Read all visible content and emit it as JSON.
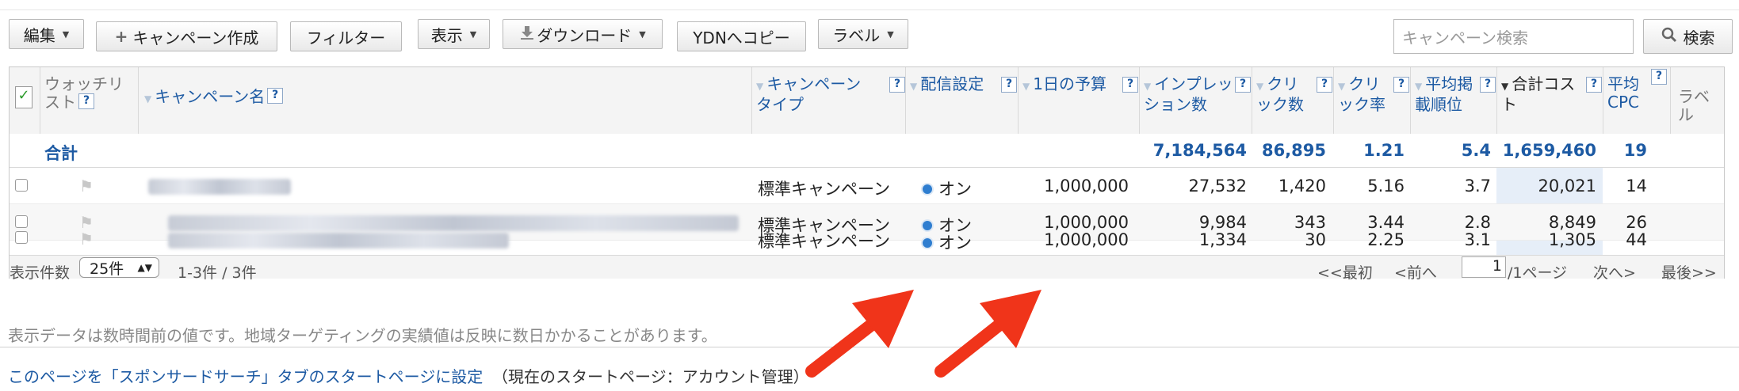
{
  "toolbar": {
    "edit": "編集",
    "create": "キャンペーン作成",
    "filter": "フィルター",
    "display": "表示",
    "download": "ダウンロード",
    "ydn": "YDNへコピー",
    "label": "ラベル",
    "search_placeholder": "キャンペーン検索",
    "search_button": "検索"
  },
  "table": {
    "headers": {
      "watch": "ウォッチリスト",
      "name": "キャンペーン名",
      "type": "キャンペーンタイプ",
      "delivery": "配信設定",
      "budget": "1日の予算",
      "impressions": "インプレッション数",
      "clicks": "クリック数",
      "ctr": "クリック率",
      "avg_pos": "平均掲載順位",
      "cost": "合計コスト",
      "cpc": "平均CPC",
      "label": "ラベル"
    },
    "total": {
      "label": "合計",
      "impressions": "7,184,564",
      "clicks": "86,895",
      "ctr": "1.21",
      "avg_pos": "5.4",
      "cost": "1,659,460",
      "cpc": "19"
    },
    "rows": [
      {
        "type": "標準キャンペーン",
        "delivery": "オン",
        "budget": "1,000,000",
        "impressions": "27,532",
        "clicks": "1,420",
        "ctr": "5.16",
        "avg_pos": "3.7",
        "cost": "20,021",
        "cpc": "14"
      },
      {
        "type": "標準キャンペーン",
        "delivery": "オン",
        "budget": "1,000,000",
        "impressions": "9,984",
        "clicks": "343",
        "ctr": "3.44",
        "avg_pos": "2.8",
        "cost": "8,849",
        "cpc": "26"
      },
      {
        "type": "標準キャンペーン",
        "delivery": "オン",
        "budget": "1,000,000",
        "impressions": "1,334",
        "clicks": "30",
        "ctr": "2.25",
        "avg_pos": "3.1",
        "cost": "1,305",
        "cpc": "44"
      }
    ],
    "footer": {
      "per_page_label": "表示件数",
      "per_page_value": "25件",
      "range": "1-3件 / 3件",
      "first": "<<最初",
      "prev": "<前へ",
      "page": "1",
      "page_total": "/1ページ",
      "next": "次へ>",
      "last": "最後>>"
    }
  },
  "note": "表示データは数時間前の値です。地域ターゲティングの実績値は反映に数日かかることがあります。",
  "start_link": "このページを「スポンサードサーチ」タブのスタートページに設定",
  "start_current": "（現在のスタートページ：アカウント管理）",
  "colors": {
    "link": "#1d5aa3",
    "arrow": "#f0341a",
    "sorted_column": "#e6eef8"
  }
}
